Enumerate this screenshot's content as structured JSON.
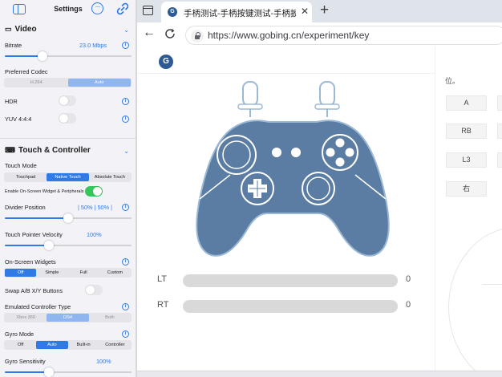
{
  "sidebar": {
    "title": "Settings",
    "video": {
      "heading": "Video",
      "bitrate": {
        "label": "Bitrate",
        "value": "23.0 Mbps",
        "fraction": 0.3
      },
      "codec": {
        "label": "Preferred Codec",
        "options": [
          "H.264",
          "Auto"
        ],
        "selected": "Auto"
      },
      "hdr": {
        "label": "HDR",
        "on": false
      },
      "yuv": {
        "label": "YUV 4:4:4",
        "on": false
      }
    },
    "touch": {
      "heading": "Touch & Controller",
      "mode": {
        "label": "Touch Mode",
        "options": [
          "Touchpad",
          "Native Touch",
          "Absolute Touch"
        ],
        "selected": "Native Touch"
      },
      "onscreen_toggle": {
        "label": "Enable On-Screen Widget & Peripherals",
        "on": true
      },
      "divider": {
        "label": "Divider Position",
        "value": "| 50% | 50% |",
        "fraction": 0.5
      },
      "pointer": {
        "label": "Touch Pointer Velocity",
        "value": "100%",
        "fraction": 0.35
      },
      "widgets": {
        "label": "On-Screen Widgets",
        "options": [
          "Off",
          "Simple",
          "Full",
          "Custom"
        ],
        "selected": "Off"
      },
      "swap": {
        "label": "Swap A/B X/Y Buttons",
        "on": false
      },
      "emulated": {
        "label": "Emulated Controller Type",
        "options": [
          "Xbox 360",
          "DS4",
          "Both"
        ],
        "selected": "DS4"
      },
      "gyro_mode": {
        "label": "Gyro Mode",
        "options": [
          "Off",
          "Auto",
          "Built-in",
          "Controller"
        ],
        "selected": "Auto"
      },
      "gyro_sens": {
        "label": "Gyro Sensitivity",
        "value": "100%",
        "fraction": 0.35
      }
    }
  },
  "browser": {
    "tab_title": "手柄测试-手柄按键测试-手柄扳机",
    "url": "https://www.gobing.cn/experiment/key",
    "logo_letter": "G",
    "triggers": [
      {
        "name": "LT",
        "value": "0",
        "fraction": 0
      },
      {
        "name": "RT",
        "value": "0",
        "fraction": 0
      }
    ],
    "right_panel": {
      "note": "位。",
      "keys": [
        "A",
        "RB",
        "L3",
        "右"
      ]
    },
    "colors": {
      "pad": "#5b7da3",
      "pad_dark": "#4c6f96",
      "accent": "#2f7ae5"
    }
  }
}
